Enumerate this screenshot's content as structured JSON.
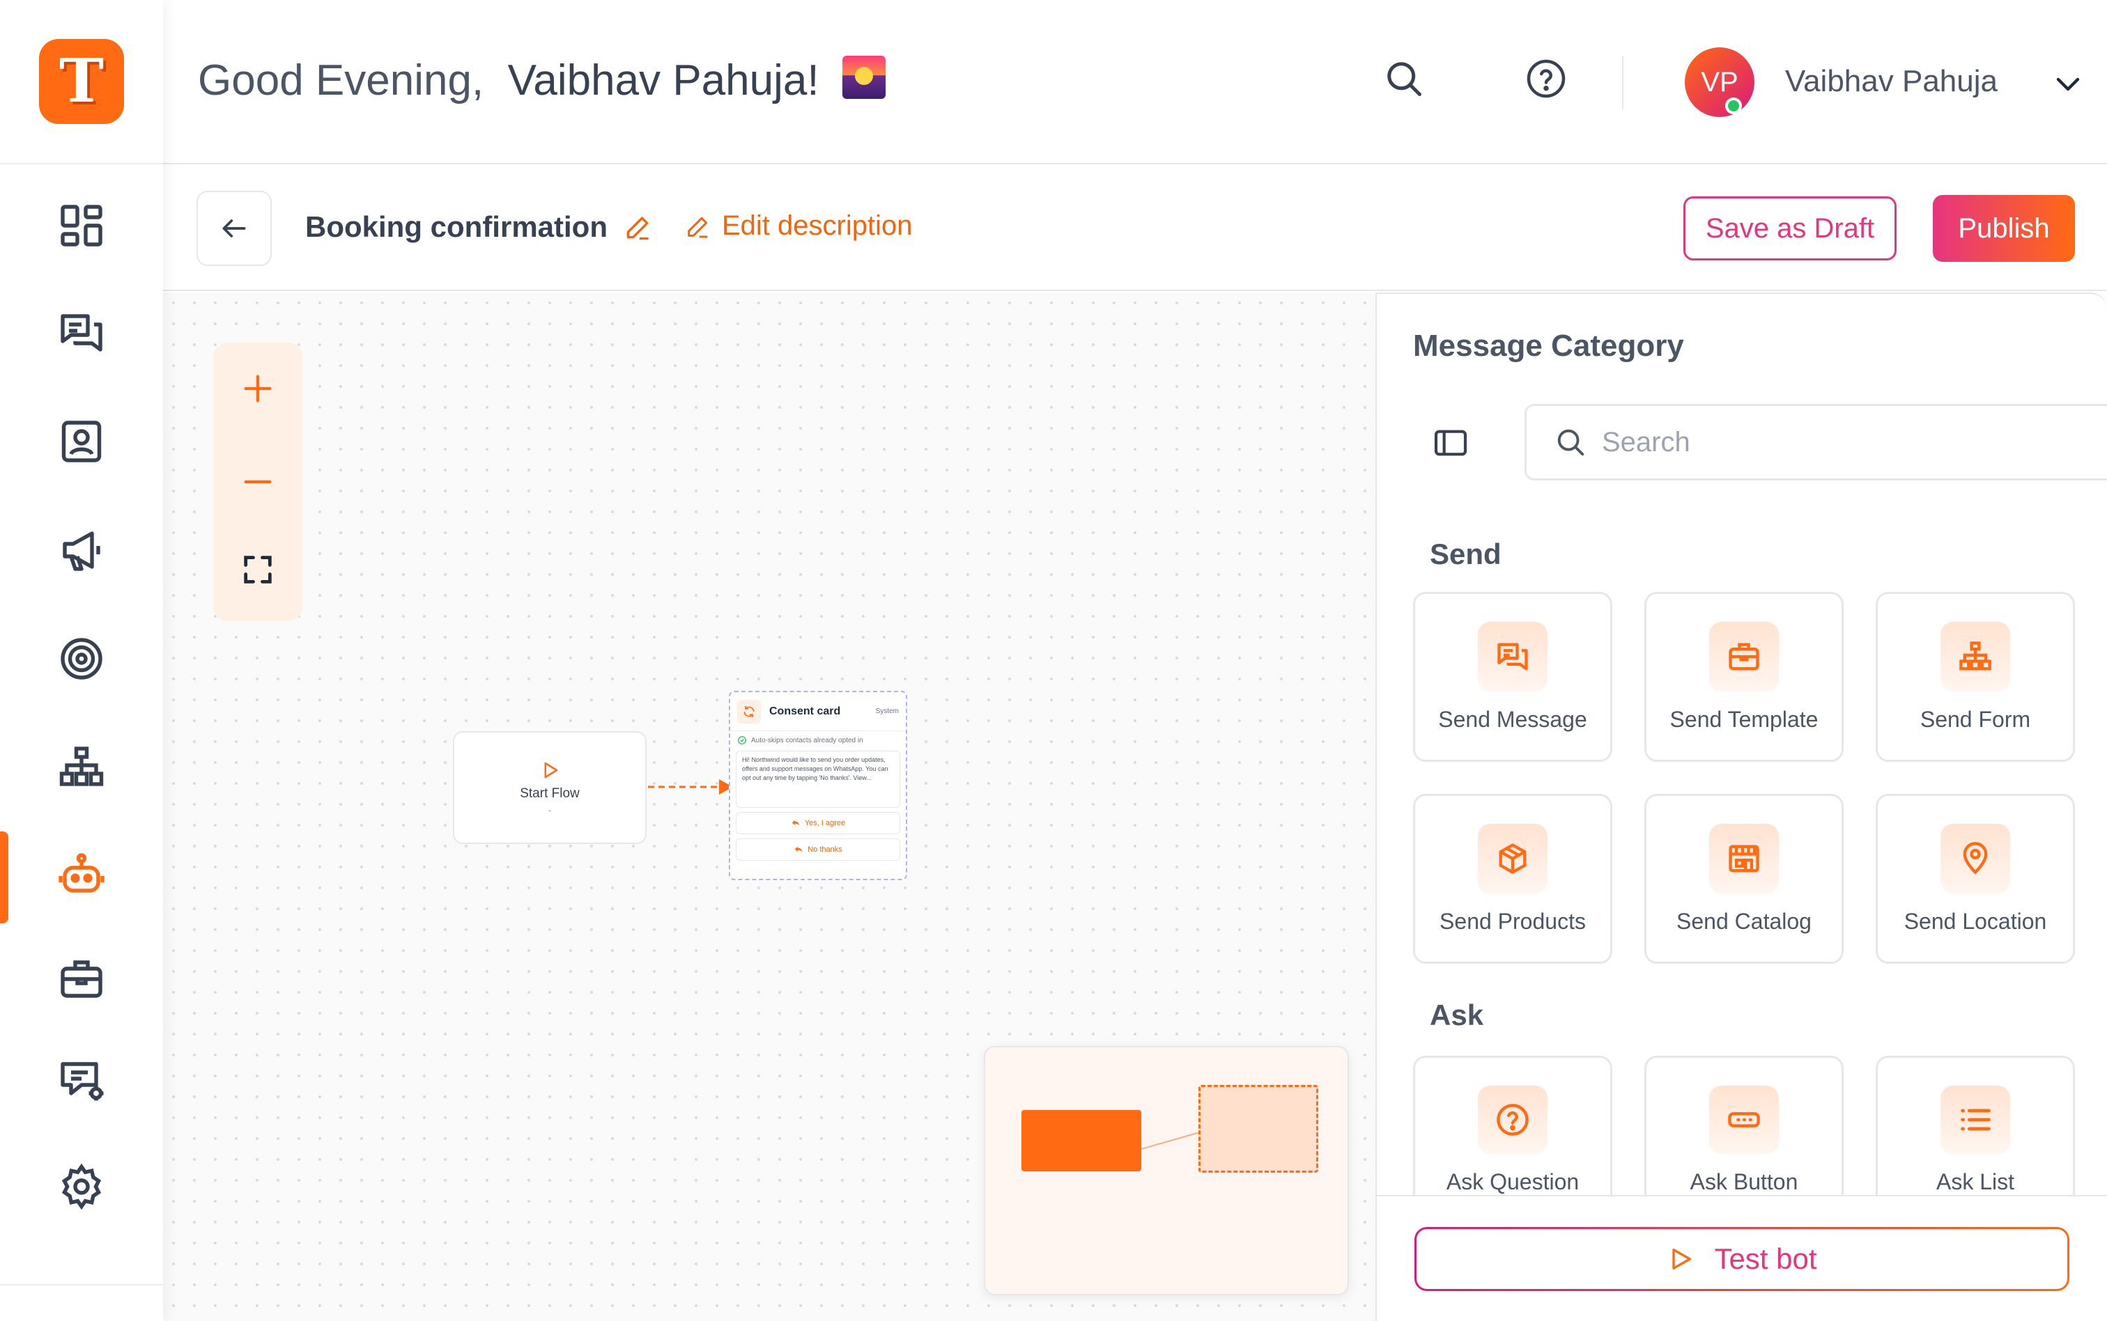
{
  "app": {
    "logo_letter": "T",
    "brand_color": "#ff6a13",
    "accent_pink": "#e6357f"
  },
  "sidebar": {
    "items": [
      {
        "name": "dashboard",
        "icon": "dashboard-icon"
      },
      {
        "name": "chats",
        "icon": "chat-bubbles-icon"
      },
      {
        "name": "contacts",
        "icon": "contact-card-icon"
      },
      {
        "name": "campaigns",
        "icon": "megaphone-icon"
      },
      {
        "name": "goals",
        "icon": "target-icon"
      },
      {
        "name": "flows",
        "icon": "org-chart-icon"
      },
      {
        "name": "bots",
        "icon": "robot-icon",
        "active": true
      },
      {
        "name": "templates",
        "icon": "briefcase-icon"
      },
      {
        "name": "automation",
        "icon": "message-settings-icon"
      },
      {
        "name": "settings",
        "icon": "gear-icon"
      }
    ]
  },
  "header": {
    "greeting": "Good Evening,",
    "user_name_in_greeting": "Vaibhav Pahuja!",
    "greeting_emoji": "sunset-image",
    "user": {
      "initials": "VP",
      "name": "Vaibhav Pahuja",
      "status": "online"
    }
  },
  "toolbar": {
    "flow_title": "Booking confirmation",
    "edit_description_label": "Edit description",
    "save_draft_label": "Save as Draft",
    "publish_label": "Publish"
  },
  "canvas": {
    "start_node": {
      "label": "Start Flow",
      "sublabel": "-"
    },
    "consent_node": {
      "title": "Consent card",
      "tag": "System",
      "check_text": "Auto-skips contacts already opted in",
      "message": "Hi! Northwind would like to send you order updates, offers and support messages on WhatsApp. You can opt out any time by tapping 'No thanks'. View...",
      "buttons": [
        "Yes, I agree",
        "No thanks"
      ]
    }
  },
  "panel": {
    "title": "Message Category",
    "search_placeholder": "Search",
    "sections": [
      {
        "heading": "Send",
        "items": [
          {
            "label": "Send Message",
            "icon": "chat-bubbles-icon"
          },
          {
            "label": "Send Template",
            "icon": "briefcase-icon"
          },
          {
            "label": "Send Form",
            "icon": "org-chart-icon"
          },
          {
            "label": "Send Products",
            "icon": "box-icon"
          },
          {
            "label": "Send Catalog",
            "icon": "storefront-icon"
          },
          {
            "label": "Send Location",
            "icon": "map-pin-icon"
          }
        ]
      },
      {
        "heading": "Ask",
        "items": [
          {
            "label": "Ask Question",
            "icon": "question-circle-icon"
          },
          {
            "label": "Ask Button",
            "icon": "button-icon"
          },
          {
            "label": "Ask List",
            "icon": "list-icon"
          }
        ]
      }
    ],
    "test_bot_label": "Test bot"
  }
}
